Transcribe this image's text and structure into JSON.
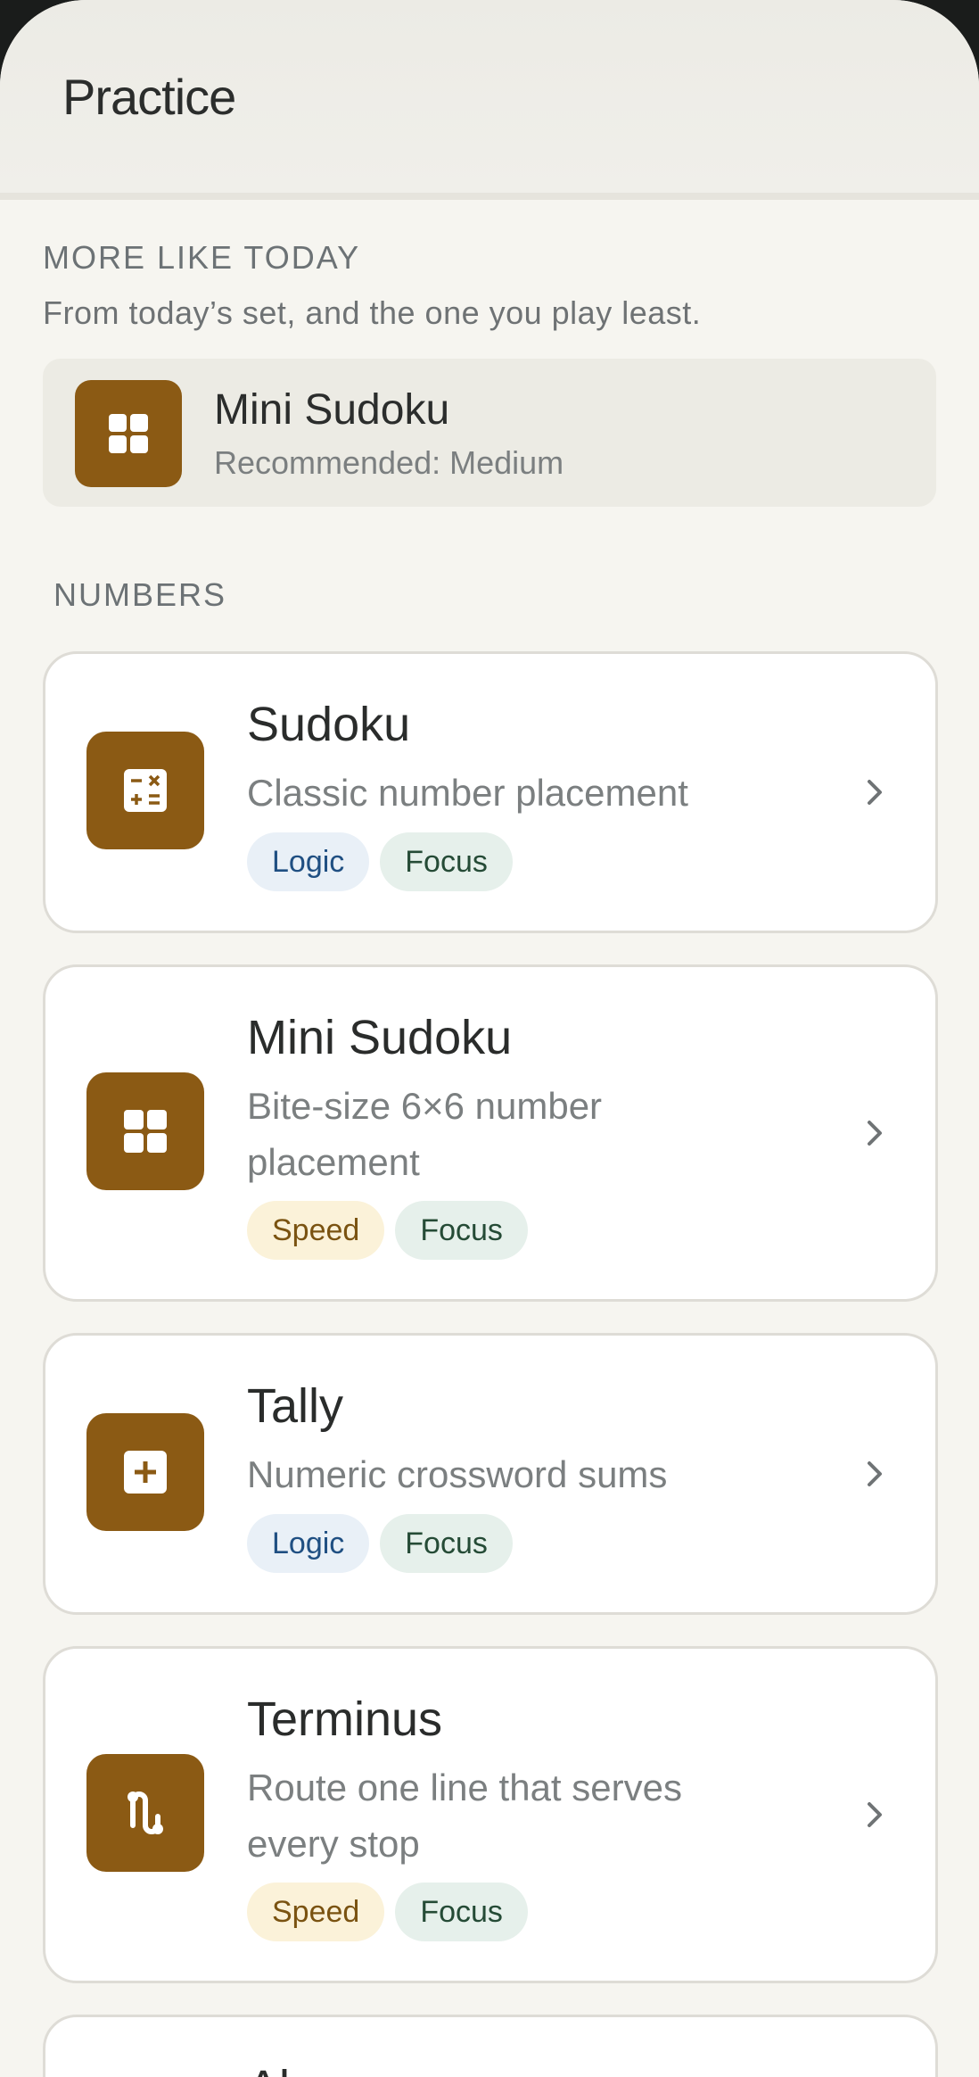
{
  "header": {
    "title": "Practice"
  },
  "recommend": {
    "section_title": "MORE LIKE TODAY",
    "subtitle": "From today’s set, and the one you play least.",
    "name": "Mini Sudoku",
    "meta": "Recommended: Medium",
    "icon": "grid-icon"
  },
  "numbers": {
    "section_title": "NUMBERS",
    "cards": [
      {
        "name": "Sudoku",
        "desc": "Classic number placement",
        "icon": "calculator-icon",
        "tags": [
          "Logic",
          "Focus"
        ]
      },
      {
        "name": "Mini Sudoku",
        "desc": "Bite-size 6×6 number placement",
        "icon": "grid-icon",
        "tags": [
          "Speed",
          "Focus"
        ]
      },
      {
        "name": "Tally",
        "desc": "Numeric crossword sums",
        "icon": "plus-box-icon",
        "tags": [
          "Logic",
          "Focus"
        ]
      },
      {
        "name": "Terminus",
        "desc": "Route one line that serves every stop",
        "icon": "route-icon",
        "tags": [
          "Speed",
          "Focus"
        ]
      },
      {
        "name": "Al",
        "desc": "",
        "icon": "",
        "tags": []
      }
    ]
  },
  "colors": {
    "accent": "#8b5a14",
    "background": "#f6f5f0",
    "tag_logic": "#e9f0f7",
    "tag_focus": "#e6f0eb",
    "tag_speed": "#fbf2d9"
  }
}
